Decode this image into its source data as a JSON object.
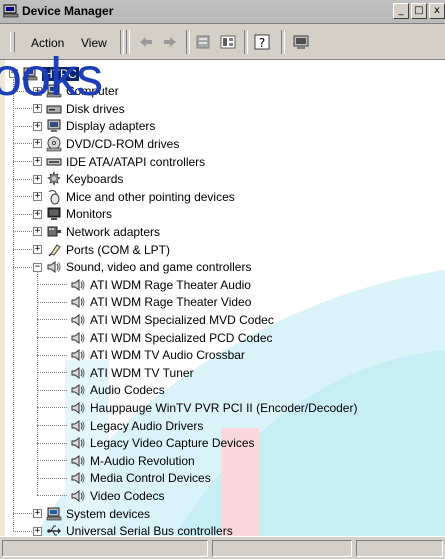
{
  "window": {
    "title": "Device Manager",
    "controls": {
      "minimize": "_",
      "maximize": "□",
      "close": "x"
    }
  },
  "menu": {
    "action": "Action",
    "view": "View"
  },
  "toolbar": {
    "icons": [
      "back-arrow-icon",
      "forward-arrow-icon",
      "properties-icon",
      "view-icon",
      "help-icon",
      "scan-hardware-icon"
    ]
  },
  "overlay_text": "ooks",
  "tree": {
    "root": "HTPC",
    "categories": [
      {
        "label": "Computer",
        "icon": "computer-icon",
        "expanded": false
      },
      {
        "label": "Disk drives",
        "icon": "disk-drive-icon",
        "expanded": false
      },
      {
        "label": "Display adapters",
        "icon": "display-adapter-icon",
        "expanded": false
      },
      {
        "label": "DVD/CD-ROM drives",
        "icon": "cdrom-icon",
        "expanded": false
      },
      {
        "label": "IDE ATA/ATAPI controllers",
        "icon": "ide-controller-icon",
        "expanded": false
      },
      {
        "label": "Keyboards",
        "icon": "keyboard-icon",
        "expanded": false
      },
      {
        "label": "Mice and other pointing devices",
        "icon": "mouse-icon",
        "expanded": false
      },
      {
        "label": "Monitors",
        "icon": "monitor-icon",
        "expanded": false
      },
      {
        "label": "Network adapters",
        "icon": "network-adapter-icon",
        "expanded": false
      },
      {
        "label": "Ports (COM & LPT)",
        "icon": "port-icon",
        "expanded": false
      },
      {
        "label": "Sound, video and game controllers",
        "icon": "speaker-icon",
        "expanded": true
      }
    ],
    "sound_devices": [
      "ATI WDM Rage Theater Audio",
      "ATI WDM Rage Theater Video",
      "ATI WDM Specialized MVD Codec",
      "ATI WDM Specialized PCD Codec",
      "ATI WDM TV Audio Crossbar",
      "ATI WDM TV Tuner",
      "Audio Codecs",
      "Hauppauge WinTV PVR PCI II (Encoder/Decoder)",
      "Legacy Audio Drivers",
      "Legacy Video Capture Devices",
      "M-Audio Revolution",
      "Media Control Devices",
      "Video Codecs"
    ],
    "tail_categories": [
      {
        "label": "System devices",
        "icon": "system-devices-icon"
      },
      {
        "label": "Universal Serial Bus controllers",
        "icon": "usb-icon"
      }
    ],
    "expand_symbol": "+",
    "collapse_symbol": "−"
  },
  "colors": {
    "overlay_blue": "#1c3fb8",
    "watermark_cyan": "#34c0d8",
    "watermark_red": "#e5464a",
    "chrome": "#d4d0c8"
  }
}
